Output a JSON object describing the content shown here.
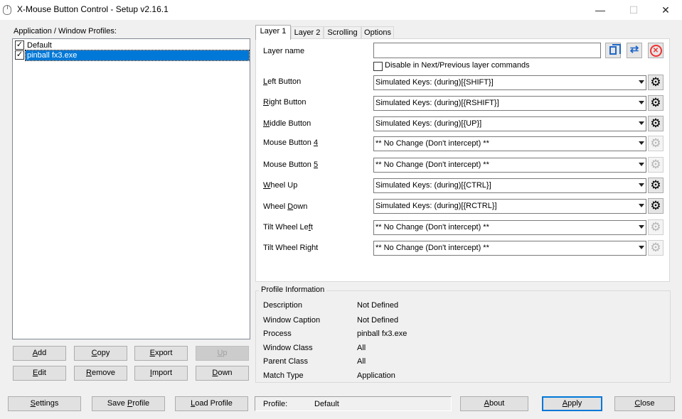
{
  "window": {
    "title": "X-Mouse Button Control - Setup v2.16.1",
    "minimize": "—",
    "maximize": "☐",
    "close": "✕"
  },
  "profiles": {
    "label": "Application / Window Profiles:",
    "items": [
      {
        "label": "Default",
        "checked": true,
        "selected": false
      },
      {
        "label": "pinball fx3.exe",
        "checked": true,
        "selected": true
      }
    ],
    "buttons": {
      "add": "Add",
      "copy": "Copy",
      "export": "Export",
      "up": "Up",
      "edit": "Edit",
      "remove": "Remove",
      "import": "Import",
      "down": "Down"
    }
  },
  "tabs": [
    "Layer 1",
    "Layer 2",
    "Scrolling",
    "Options"
  ],
  "layer": {
    "name_label": "Layer name",
    "name_value": "",
    "disable_label": "Disable in Next/Previous layer commands",
    "disable_checked": false,
    "buttons": [
      {
        "label": "Left Button",
        "value": "Simulated Keys: (during)[{SHIFT}]",
        "enabled": true
      },
      {
        "label": "Right Button",
        "value": "Simulated Keys: (during)[{RSHIFT}]",
        "enabled": true
      },
      {
        "label": "Middle Button",
        "value": "Simulated Keys: (during)[{UP}]",
        "enabled": true
      },
      {
        "label": "Mouse Button 4",
        "value": "** No Change (Don't intercept) **",
        "enabled": false
      },
      {
        "label": "Mouse Button 5",
        "value": "** No Change (Don't intercept) **",
        "enabled": false
      },
      {
        "label": "Wheel Up",
        "value": "Simulated Keys: (during)[{CTRL}]",
        "enabled": true
      },
      {
        "label": "Wheel Down",
        "value": "Simulated Keys: (during)[{RCTRL}]",
        "enabled": true
      },
      {
        "label": "Tilt Wheel Left",
        "value": "** No Change (Don't intercept) **",
        "enabled": false
      },
      {
        "label": "Tilt Wheel Right",
        "value": "** No Change (Don't intercept) **",
        "enabled": false
      }
    ]
  },
  "profile_info": {
    "title": "Profile Information",
    "rows": [
      {
        "label": "Description",
        "value": "Not Defined"
      },
      {
        "label": "Window Caption",
        "value": "Not Defined"
      },
      {
        "label": "Process",
        "value": "pinball fx3.exe"
      },
      {
        "label": "Window Class",
        "value": "All"
      },
      {
        "label": "Parent Class",
        "value": "All"
      },
      {
        "label": "Match Type",
        "value": "Application"
      }
    ]
  },
  "footer": {
    "settings": "Settings",
    "save_profile": "Save Profile",
    "load_profile": "Load Profile",
    "profile_label": "Profile:",
    "profile_value": "Default",
    "about": "About",
    "apply": "Apply",
    "close": "Close"
  },
  "icons": {
    "copy_layer": "copy-icon",
    "swap_layer": "swap-icon",
    "clear_layer": "clear-icon",
    "gear": "gear-icon"
  }
}
